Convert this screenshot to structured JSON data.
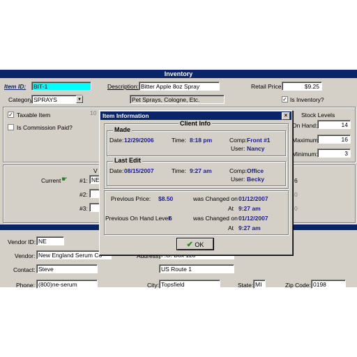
{
  "window": {
    "title": "Inventory"
  },
  "item": {
    "item_id_label": "Item ID:",
    "item_id_value": "BIT-1",
    "description_label": "Description:",
    "description_value": "Bitter Apple 8oz Spray",
    "retail_price_label": "Retail Price:",
    "retail_price_value": "$9.25",
    "category_label": "Category:",
    "category_value": "SPRAYS",
    "category_desc": "Pet Sprays, Cologne, Etc.",
    "is_inventory_label": "Is Inventory?",
    "taxable_label": "Taxable Item",
    "commission_label": "Is Commission Paid?",
    "taxable_partial": "10"
  },
  "stock": {
    "title": "Stock Levels",
    "on_hand_label": "On Hand:",
    "on_hand_value": "14",
    "maximum_label": "Maximum:",
    "maximum_value": "16",
    "minimum_label": "Minimum:",
    "minimum_value": "3"
  },
  "vendor_rows": {
    "current_label": "Current",
    "row1_label": "#1:",
    "row1_value": "NE",
    "row2_label": "#2:",
    "row3_label": "#3:",
    "col_partial": "V",
    "right_partial_1": "6",
    "right_partial_2": "0",
    "right_partial_3": "0"
  },
  "vendor": {
    "vendor_id_label": "Vendor ID:",
    "vendor_id_value": "NE",
    "vendor_label": "Vendor:",
    "vendor_value": "New England Serum Co",
    "contact_label": "Contact:",
    "contact_value": "Steve",
    "phone_label": "Phone:",
    "phone_value": "(800)ne-serum",
    "address_label": "Address:",
    "address_partial": "P.O. Box 128",
    "address2_value": "US Route 1",
    "city_label": "City:",
    "city_value": "Topsfield",
    "state_label": "State:",
    "state_value": "MI",
    "zip_label": "Zip Code:",
    "zip_value": "0198"
  },
  "dialog": {
    "title": "Item Information",
    "close": "×",
    "client_info_title": "Client Info",
    "made": {
      "title": "Made",
      "date_label": "Date:",
      "date_value": "12/29/2006",
      "time_label": "Time:",
      "time_value": "8:18 pm",
      "comp_label": "Comp:",
      "comp_value": "Front #1",
      "user_label": "User:",
      "user_value": "Nancy"
    },
    "last_edit": {
      "title": "Last Edit",
      "date_label": "Date:",
      "date_value": "08/15/2007",
      "time_label": "Time:",
      "time_value": "9:27 am",
      "comp_label": "Comp:",
      "comp_value": "Office",
      "user_label": "User:",
      "user_value": "Becky"
    },
    "price": {
      "prev_price_label": "Previous Price:",
      "prev_price_value": "$8.50",
      "changed_on_label": "was Changed on",
      "changed_on_value": "01/12/2007",
      "at_label": "At",
      "at_value": "9:27 am"
    },
    "onhand": {
      "prev_onhand_label": "Previous On Hand Level:",
      "prev_onhand_value": "6",
      "changed_on_label": "was Changed on",
      "changed_on_value": "01/12/2007",
      "at_label": "At",
      "at_value": "9:27 am"
    },
    "ok_label": "OK"
  }
}
